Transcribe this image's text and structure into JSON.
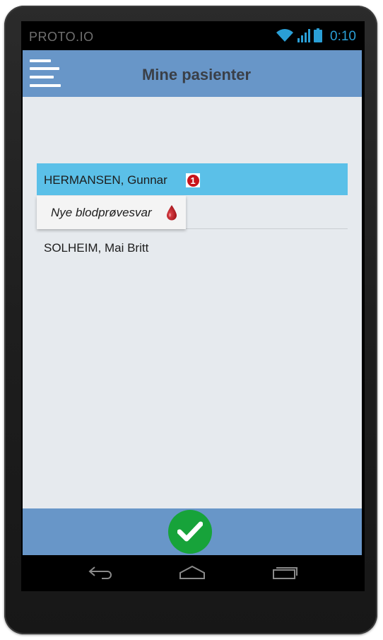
{
  "status_bar": {
    "carrier": "PROTO.IO",
    "time": "0:10",
    "icons": [
      "wifi-icon",
      "signal-icon",
      "battery-icon"
    ]
  },
  "header": {
    "title": "Mine pasienter",
    "menu_icon": "hamburger-menu-icon"
  },
  "patients": [
    {
      "name": "HERMANSEN, Gunnar",
      "badge_count": "1",
      "selected": true
    },
    {
      "name": "SOLHEIM, Mai Britt",
      "selected": false
    }
  ],
  "popup": {
    "text": "Nye blodprøvesvar",
    "icon": "blood-drop-icon"
  },
  "footer": {
    "confirm_icon": "checkmark-icon"
  },
  "system_nav": [
    "back-icon",
    "home-icon",
    "recent-apps-icon"
  ],
  "colors": {
    "header_bg": "#6896c8",
    "selected_row_bg": "#5bc0e8",
    "content_bg": "#e6eaee",
    "badge_red": "#c8131b",
    "confirm_green": "#17a33a",
    "time_blue": "#2a9fd6"
  }
}
